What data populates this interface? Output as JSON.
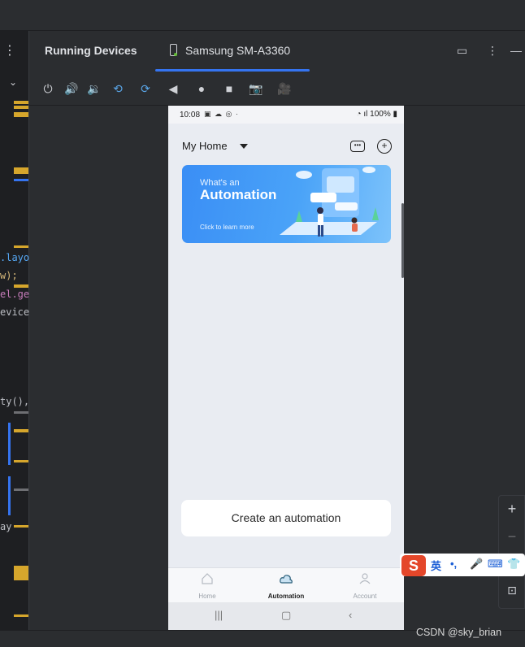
{
  "ide": {
    "tool_window_title": "Running Devices",
    "device_tab_label": "Samsung SM-A3360",
    "code_snippets": [
      ".layo",
      "w);",
      "el.ge",
      "evice",
      "ty(),",
      "ay"
    ],
    "watermark": "CSDN @sky_brian"
  },
  "phone": {
    "status_time": "10:08",
    "battery": "100%",
    "home_label": "My Home",
    "banner": {
      "pretitle": "What's an",
      "title": "Automation",
      "cta": "Click to learn more"
    },
    "create_button": "Create an automation",
    "nav": [
      {
        "label": "Home",
        "active": false
      },
      {
        "label": "Automation",
        "active": true
      },
      {
        "label": "Account",
        "active": false
      }
    ]
  },
  "ime": {
    "lang": "英",
    "punct": "•,",
    "logo": "S"
  },
  "colors": {
    "ide_bg": "#2b2d30",
    "accent_blue": "#3574f0",
    "banner_blue": "#3a8ef5",
    "gutter_yellow": "#d6a62c",
    "ime_red": "#e4472a"
  }
}
